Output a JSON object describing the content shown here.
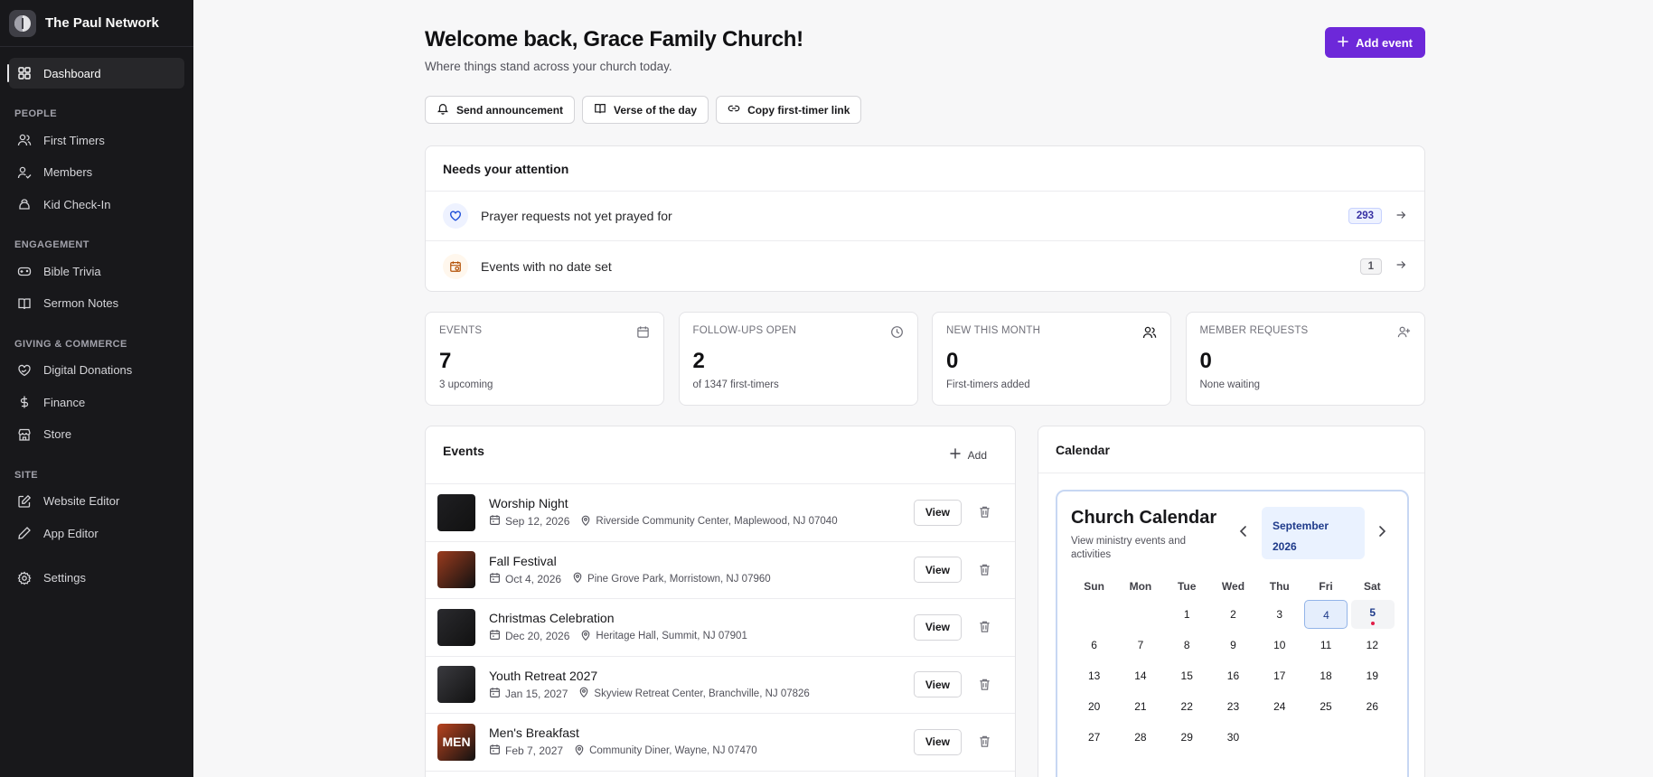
{
  "brand": {
    "name": "The Paul Network"
  },
  "sidebar": {
    "items": [
      {
        "label": "Dashboard",
        "icon": "dashboard-icon",
        "active": true
      }
    ],
    "sections": [
      {
        "title": "PEOPLE",
        "items": [
          {
            "label": "First Timers",
            "icon": "users-icon"
          },
          {
            "label": "Members",
            "icon": "user-check-icon"
          },
          {
            "label": "Kid Check-In",
            "icon": "kid-icon"
          }
        ]
      },
      {
        "title": "ENGAGEMENT",
        "items": [
          {
            "label": "Bible Trivia",
            "icon": "gamepad-icon"
          },
          {
            "label": "Sermon Notes",
            "icon": "book-icon"
          }
        ]
      },
      {
        "title": "GIVING & COMMERCE",
        "items": [
          {
            "label": "Digital Donations",
            "icon": "heart-hand-icon"
          },
          {
            "label": "Finance",
            "icon": "dollar-icon"
          },
          {
            "label": "Store",
            "icon": "store-icon"
          }
        ]
      },
      {
        "title": "SITE",
        "items": [
          {
            "label": "Website Editor",
            "icon": "edit-icon"
          },
          {
            "label": "App Editor",
            "icon": "pen-icon"
          }
        ]
      }
    ],
    "settings": {
      "label": "Settings",
      "icon": "gear-icon"
    }
  },
  "header": {
    "title": "Welcome back, Grace Family Church!",
    "subtitle": "Where things stand across your church today.",
    "add_event": "Add event"
  },
  "quick_actions": [
    {
      "label": "Send announcement",
      "icon": "bell-icon"
    },
    {
      "label": "Verse of the day",
      "icon": "book-open-icon"
    },
    {
      "label": "Copy first-timer link",
      "icon": "link-icon"
    }
  ],
  "attention": {
    "title": "Needs your attention",
    "rows": [
      {
        "label": "Prayer requests not yet prayed for",
        "count": "293",
        "style": "blue"
      },
      {
        "label": "Events with no date set",
        "count": "1",
        "style": "gray"
      }
    ]
  },
  "stats": [
    {
      "label": "EVENTS",
      "value": "7",
      "sub": "3 upcoming",
      "icon": "calendar-icon"
    },
    {
      "label": "FOLLOW-UPS OPEN",
      "value": "2",
      "sub": "of 1347 first-timers",
      "icon": "clock-icon"
    },
    {
      "label": "NEW THIS MONTH",
      "value": "0",
      "sub": "First-timers added",
      "icon": "users-icon"
    },
    {
      "label": "MEMBER REQUESTS",
      "value": "0",
      "sub": "None waiting",
      "icon": "user-plus-icon"
    }
  ],
  "events": {
    "title": "Events",
    "add_label": "Add",
    "view_label": "View",
    "items": [
      {
        "name": "Worship Night",
        "date": "Sep 12, 2026",
        "location": "Riverside Community Center, Maplewood, NJ 07040",
        "thumb_color": "#1f1f22"
      },
      {
        "name": "Fall Festival",
        "date": "Oct 4, 2026",
        "location": "Pine Grove Park, Morristown, NJ 07960",
        "thumb_color": "#9a3b1e"
      },
      {
        "name": "Christmas Celebration",
        "date": "Dec 20, 2026",
        "location": "Heritage Hall, Summit, NJ 07901",
        "thumb_color": "#2a2a2e"
      },
      {
        "name": "Youth Retreat 2027",
        "date": "Jan 15, 2027",
        "location": "Skyview Retreat Center, Branchville, NJ 07826",
        "thumb_color": "#3a3a3f"
      },
      {
        "name": "Men's Breakfast",
        "date": "Feb 7, 2027",
        "location": "Community Diner, Wayne, NJ 07470",
        "thumb_color": "#b8431f",
        "thumb_text": "MEN"
      }
    ]
  },
  "calendar": {
    "card_title": "Calendar",
    "title": "Church Calendar",
    "description": "View ministry events and activities",
    "month": "September",
    "year": "2026",
    "dows": [
      "Sun",
      "Mon",
      "Tue",
      "Wed",
      "Thu",
      "Fri",
      "Sat"
    ],
    "weeks": [
      [
        "",
        "",
        "1",
        "2",
        "3",
        "4",
        "5"
      ],
      [
        "6",
        "7",
        "8",
        "9",
        "10",
        "11",
        "12"
      ],
      [
        "13",
        "14",
        "15",
        "16",
        "17",
        "18",
        "19"
      ],
      [
        "20",
        "21",
        "22",
        "23",
        "24",
        "25",
        "26"
      ],
      [
        "27",
        "28",
        "29",
        "30",
        "",
        "",
        ""
      ]
    ],
    "today": "4",
    "event_days": [
      "5"
    ]
  },
  "colors": {
    "accent": "#6d28d9",
    "sidebar_bg": "#18181b"
  }
}
